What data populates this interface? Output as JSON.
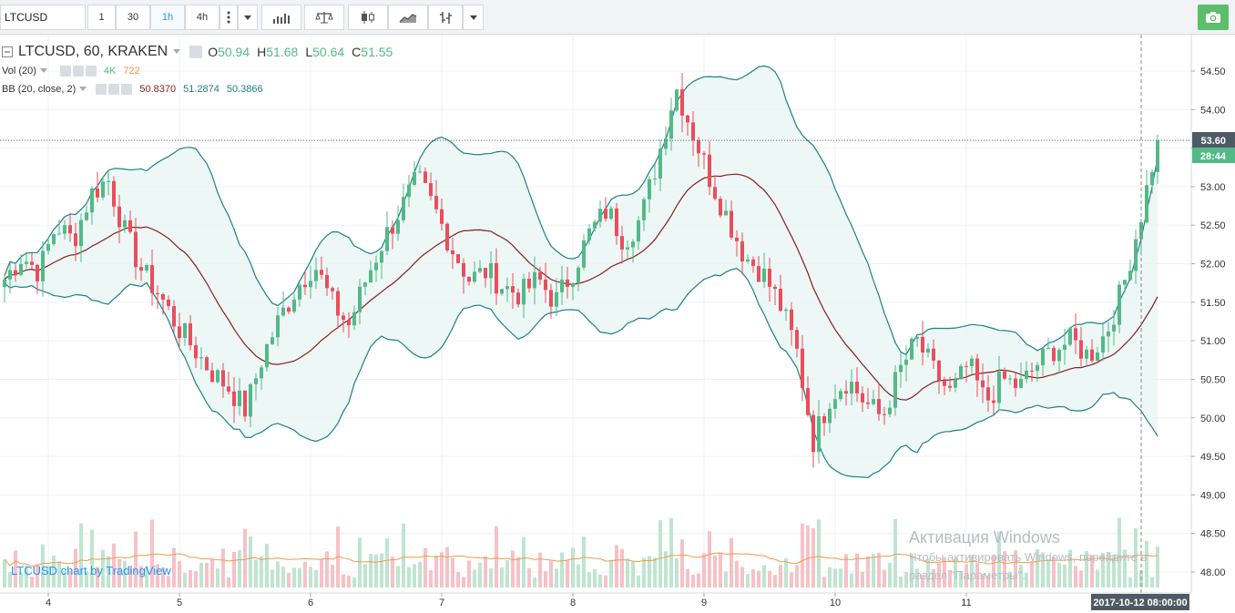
{
  "toolbar": {
    "symbol": "LTCUSD",
    "intervals": [
      "1",
      "30",
      "1h",
      "4h"
    ],
    "active_interval": "1h"
  },
  "legend": {
    "title": "LTCUSD, 60, KRAKEN",
    "o_label": "O",
    "o_value": "50.94",
    "h_label": "H",
    "h_value": "51.68",
    "l_label": "L",
    "l_value": "50.64",
    "c_label": "C",
    "c_value": "51.55",
    "vol_label": "Vol (20)",
    "vol_value1": "4K",
    "vol_value2": "722",
    "bb_label": "BB (20, close, 2)",
    "bb_value1": "50.8370",
    "bb_value2": "51.2874",
    "bb_value3": "50.3866"
  },
  "price_axis": {
    "ticks": [
      "54.50",
      "54.00",
      "53.50",
      "53.00",
      "52.50",
      "52.00",
      "51.50",
      "51.00",
      "50.50",
      "50.00",
      "49.50",
      "49.00",
      "48.50",
      "48.00"
    ],
    "current_price": "53.60",
    "countdown": "28:44"
  },
  "time_axis": {
    "ticks": [
      "4",
      "5",
      "6",
      "7",
      "8",
      "9",
      "10",
      "11"
    ],
    "crosshair_label": "2017-10-12 08:00:00"
  },
  "attribution": "LTCUSD chart by TradingView",
  "os_watermark": {
    "line1": "Активация Windows",
    "line2": "Чтобы активировать Windows, перейдите в",
    "line3": "раздел \"Параметры\"."
  },
  "colors": {
    "up": "#53b987",
    "down": "#eb4d5c",
    "bb_band": "#1e8084",
    "bb_basis": "#8c1c1f",
    "bb_fill": "#e8f5f4",
    "vol_up": "#bfe5d1",
    "vol_down": "#f6c2c7",
    "vol_ma": "#f2994a",
    "current_price_bg": "#4e5b65",
    "countdown_bg": "#53b987"
  },
  "chart_data": {
    "type": "candlestick",
    "interval": "60",
    "ylim": [
      47.85,
      54.75
    ],
    "x_day_labels": [
      "4",
      "5",
      "6",
      "7",
      "8",
      "9",
      "10",
      "11"
    ],
    "close_path": [
      51.8,
      52.1,
      51.9,
      52.5,
      52.3,
      52.9,
      53.1,
      52.4,
      51.9,
      51.6,
      51.2,
      50.9,
      50.6,
      50.4,
      50.1,
      50.8,
      51.3,
      51.7,
      52.0,
      51.5,
      51.2,
      51.8,
      52.3,
      52.7,
      53.1,
      52.7,
      52.2,
      51.8,
      51.9,
      51.7,
      51.6,
      51.8,
      51.5,
      51.9,
      52.4,
      52.7,
      52.3,
      52.6,
      53.4,
      54.3,
      53.7,
      53.1,
      52.6,
      52.1,
      51.9,
      51.5,
      50.9,
      49.7,
      50.3,
      50.5,
      50.2,
      50.0,
      50.6,
      51.0,
      50.6,
      50.3,
      50.7,
      50.2,
      50.5,
      50.4,
      50.7,
      50.9,
      51.0,
      50.8,
      51.1,
      51.7,
      52.6,
      53.6
    ],
    "bb_bands": "20-period Bollinger Bands; upper, basis and lower lines",
    "volume_ma_period": 20
  }
}
